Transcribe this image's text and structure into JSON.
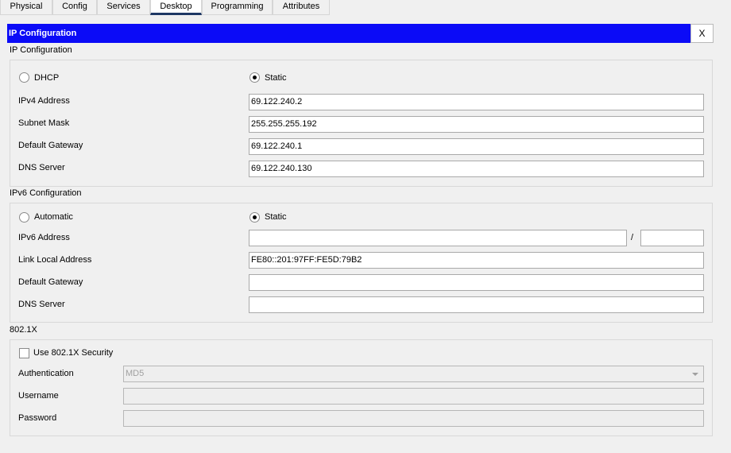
{
  "tabs": [
    "Physical",
    "Config",
    "Services",
    "Desktop",
    "Programming",
    "Attributes"
  ],
  "window": {
    "title": "IP Configuration",
    "close_label": "X"
  },
  "ipv4": {
    "section_title": "IP Configuration",
    "dhcp_label": "DHCP",
    "static_label": "Static",
    "mode": "Static",
    "address_label": "IPv4 Address",
    "address": "69.122.240.2",
    "mask_label": "Subnet Mask",
    "mask": "255.255.255.192",
    "gateway_label": "Default Gateway",
    "gateway": "69.122.240.1",
    "dns_label": "DNS Server",
    "dns": "69.122.240.130"
  },
  "ipv6": {
    "section_title": "IPv6 Configuration",
    "auto_label": "Automatic",
    "static_label": "Static",
    "mode": "Static",
    "address_label": "IPv6 Address",
    "address": "",
    "prefix": "",
    "slash": "/",
    "link_local_label": "Link Local Address",
    "link_local": "FE80::201:97FF:FE5D:79B2",
    "gateway_label": "Default Gateway",
    "gateway": "",
    "dns_label": "DNS Server",
    "dns": ""
  },
  "dot1x": {
    "section_title": "802.1X",
    "use_label": "Use 802.1X Security",
    "use_checked": false,
    "auth_label": "Authentication",
    "auth_value": "MD5",
    "username_label": "Username",
    "username": "",
    "password_label": "Password",
    "password": ""
  }
}
